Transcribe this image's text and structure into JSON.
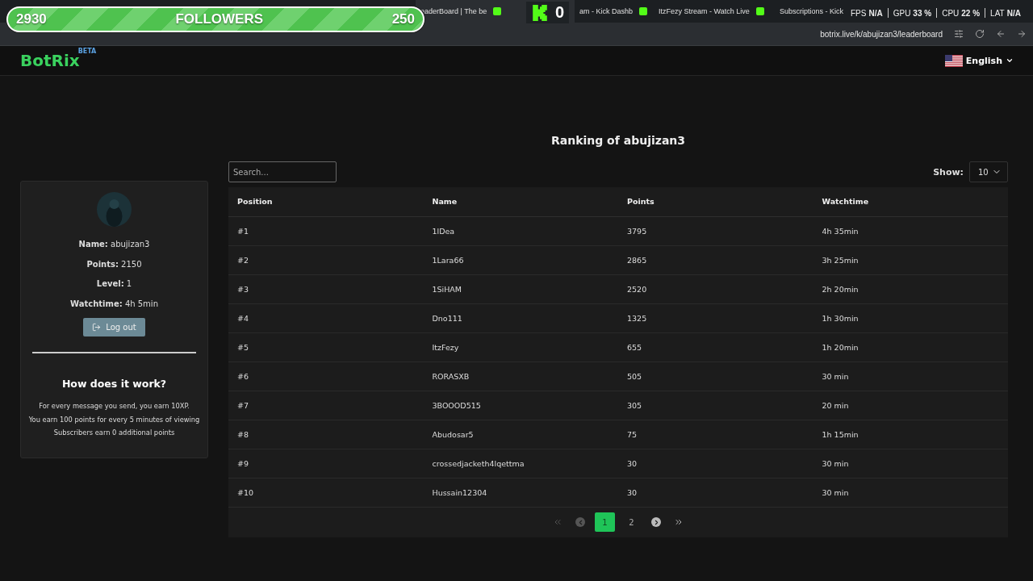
{
  "browser": {
    "tabs": [
      {
        "title": "eaderBoard | The be",
        "selected": true
      },
      {
        "title": "am - Kick Dashb",
        "selected": false
      },
      {
        "title": "ItzFezy Stream - Watch Live",
        "selected": false
      },
      {
        "title": "Subscriptions - Kick",
        "selected": false
      }
    ],
    "url": "botrix.live/k/abujizan3/leaderboard"
  },
  "overlay": {
    "followers": {
      "start": "2930",
      "label": "FOLLOWERS",
      "goal": "250"
    },
    "kick_count": "0",
    "stats": [
      {
        "label": "FPS",
        "value": "N/A"
      },
      {
        "label": "GPU",
        "value": "33 %"
      },
      {
        "label": "CPU",
        "value": "22 %"
      },
      {
        "label": "LAT",
        "value": "N/A"
      }
    ]
  },
  "header": {
    "logo": "BotRix",
    "badge": "BETA",
    "language": "English"
  },
  "profile": {
    "fields": [
      {
        "label": "Name:",
        "value": "abujizan3"
      },
      {
        "label": "Points:",
        "value": "2150"
      },
      {
        "label": "Level:",
        "value": "1"
      },
      {
        "label": "Watchtime:",
        "value": "4h 5min"
      }
    ],
    "logout": "Log out",
    "help_title": "How does it work?",
    "help_lines": [
      "For every message you send, you earn 10XP.",
      "You earn 100 points for every 5 minutes of viewing",
      "Subscribers earn 0 additional points"
    ]
  },
  "leaderboard": {
    "title": "Ranking of abujizan3",
    "search_placeholder": "Search...",
    "show_label": "Show:",
    "show_value": "10",
    "columns": [
      "Position",
      "Name",
      "Points",
      "Watchtime"
    ],
    "rows": [
      [
        "#1",
        "1lDea",
        "3795",
        "4h 35min"
      ],
      [
        "#2",
        "1Lara66",
        "2865",
        "3h 25min"
      ],
      [
        "#3",
        "1SiHAM",
        "2520",
        "2h 20min"
      ],
      [
        "#4",
        "Dno111",
        "1325",
        "1h 30min"
      ],
      [
        "#5",
        "ItzFezy",
        "655",
        "1h 20min"
      ],
      [
        "#6",
        "RORASXB",
        "505",
        "30 min"
      ],
      [
        "#7",
        "3BOOOD515",
        "305",
        "20 min"
      ],
      [
        "#8",
        "Abudosar5",
        "75",
        "1h 15min"
      ],
      [
        "#9",
        "crossedjacketh4lqettma",
        "30",
        "30 min"
      ],
      [
        "#10",
        "Hussain12304",
        "30",
        "30 min"
      ]
    ],
    "pagination": [
      {
        "kind": "first",
        "disabled": true
      },
      {
        "kind": "prev",
        "disabled": true
      },
      {
        "kind": "page",
        "label": "1",
        "selected": true
      },
      {
        "kind": "page",
        "label": "2",
        "selected": false
      },
      {
        "kind": "next",
        "disabled": false
      },
      {
        "kind": "last",
        "disabled": false
      }
    ]
  }
}
